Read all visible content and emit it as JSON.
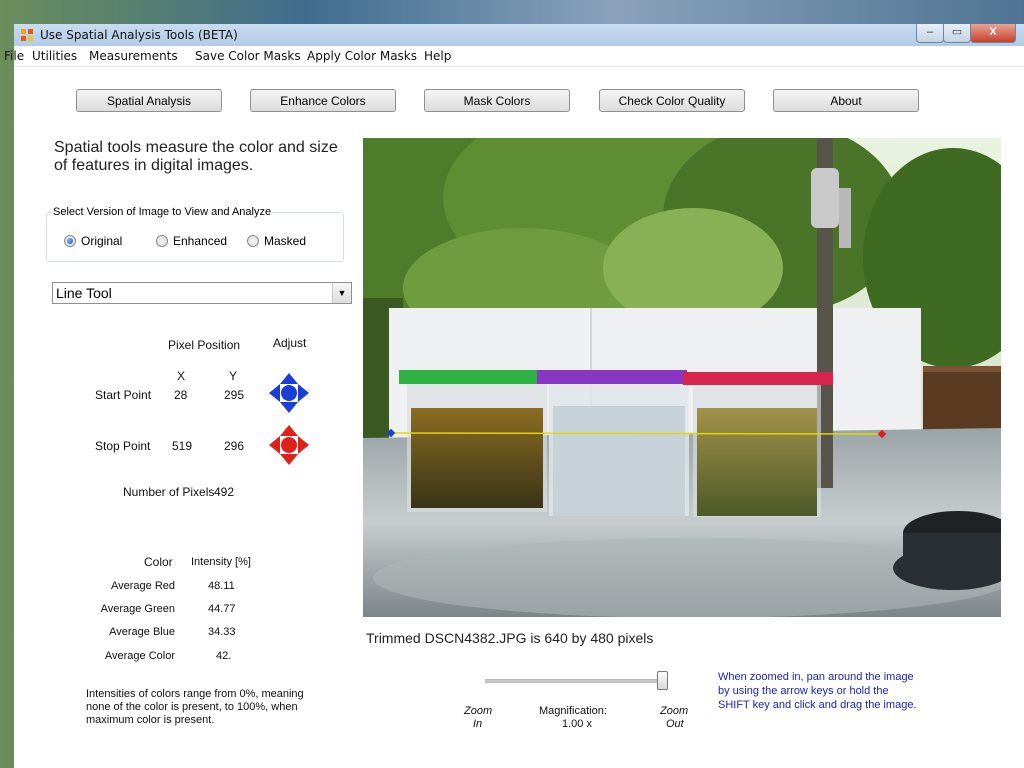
{
  "window": {
    "title": "Use Spatial Analysis Tools (BETA)",
    "minimize_label": "–",
    "restore_label": "▭",
    "close_label": "X"
  },
  "menu": [
    "File",
    "Utilities",
    "Measurements",
    "Save Color Masks",
    "Apply Color Masks",
    "Help"
  ],
  "toolbar": {
    "buttons": [
      "Spatial Analysis",
      "Enhance Colors",
      "Mask Colors",
      "Check Color Quality",
      "About"
    ]
  },
  "panel": {
    "description": "Spatial tools measure the color and size of features in digital images.",
    "group_title": "Select Version of Image to View and Analyze",
    "radios": [
      {
        "label": "Original",
        "selected": true
      },
      {
        "label": "Enhanced",
        "selected": false
      },
      {
        "label": "Masked",
        "selected": false
      }
    ],
    "tool_selected": "Line Tool",
    "pixel_position_header": "Pixel Position",
    "adjust_header": "Adjust",
    "x_header": "X",
    "y_header": "Y",
    "start_label": "Start Point",
    "start_x": "28",
    "start_y": "295",
    "stop_label": "Stop Point",
    "stop_x": "519",
    "stop_y": "296",
    "num_pixels_label": "Number of Pixels",
    "num_pixels": "492",
    "color_header": "Color",
    "intensity_header": "Intensity [%]",
    "stats": [
      {
        "label": "Average Red",
        "value": "48.11"
      },
      {
        "label": "Average Green",
        "value": "44.77"
      },
      {
        "label": "Average Blue",
        "value": "34.33"
      },
      {
        "label": "Average Color",
        "value": "42."
      }
    ],
    "note": "Intensities of colors range from 0%, meaning none of the color is present, to 100%, when maximum color is present."
  },
  "image": {
    "caption": "Trimmed DSCN4382.JPG is 640 by 480 pixels"
  },
  "zoom": {
    "zoom_in_line1": "Zoom",
    "zoom_in_line2": "In",
    "magnification_label": "Magnification:",
    "magnification_value": "1.00 x",
    "zoom_out_line1": "Zoom",
    "zoom_out_line2": "Out",
    "hint": "When zoomed in, pan around the image by using the arrow keys or hold the SHIFT key and click and drag the image."
  },
  "colors": {
    "start_adjust": "#1a3fd6",
    "stop_adjust": "#e0201a",
    "hint_text": "#1d22b8",
    "line_tool": "#e8d400"
  },
  "icons": {
    "app": "app-icon",
    "start_adjust": "blue-direction-pad-icon",
    "stop_adjust": "red-direction-pad-icon"
  }
}
